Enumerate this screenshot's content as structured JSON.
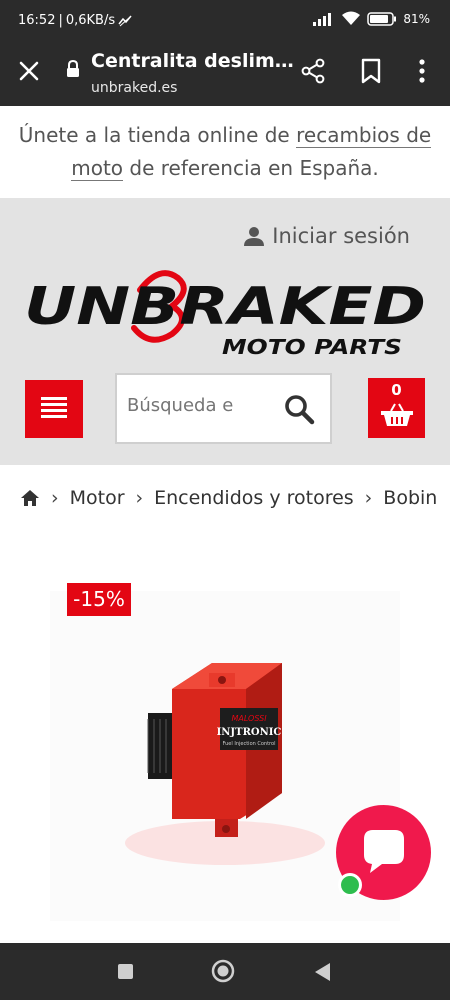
{
  "status": {
    "time": "16:52",
    "speed": "0,6KB/s",
    "battery": "81"
  },
  "chrome": {
    "title": "Centralita deslim…",
    "url": "unbraked.es"
  },
  "promo": {
    "pre": "Únete a la tienda online de ",
    "link1": "recambios de",
    "link2": "moto",
    "post": " de referencia en España."
  },
  "header": {
    "login_label": "Iniciar sesión",
    "logo_main": "UNBRAKED",
    "logo_sub": "MOTO PARTS",
    "search_placeholder": "Búsqueda e",
    "cart_count": "0"
  },
  "breadcrumb": {
    "items": [
      "Motor",
      "Encendidos y rotores",
      "Bobin"
    ]
  },
  "product": {
    "discount": "-15%",
    "device_brand": "MALOSSI",
    "device_model": "INJTRONIC",
    "device_sub": "Fuel Injection Control"
  },
  "colors": {
    "accent": "#e30613",
    "chat": "#f0194c",
    "online": "#2ebd4e",
    "dark_bar": "#2b2b2b"
  },
  "icons": [
    "close-icon",
    "lock-icon",
    "share-icon",
    "bookmark-icon",
    "more-vert-icon",
    "user-icon",
    "hamburger-icon",
    "search-icon",
    "basket-icon",
    "home-icon",
    "chevron-right-icon",
    "chat-icon",
    "nav-recents-icon",
    "nav-home-icon",
    "nav-back-icon"
  ]
}
